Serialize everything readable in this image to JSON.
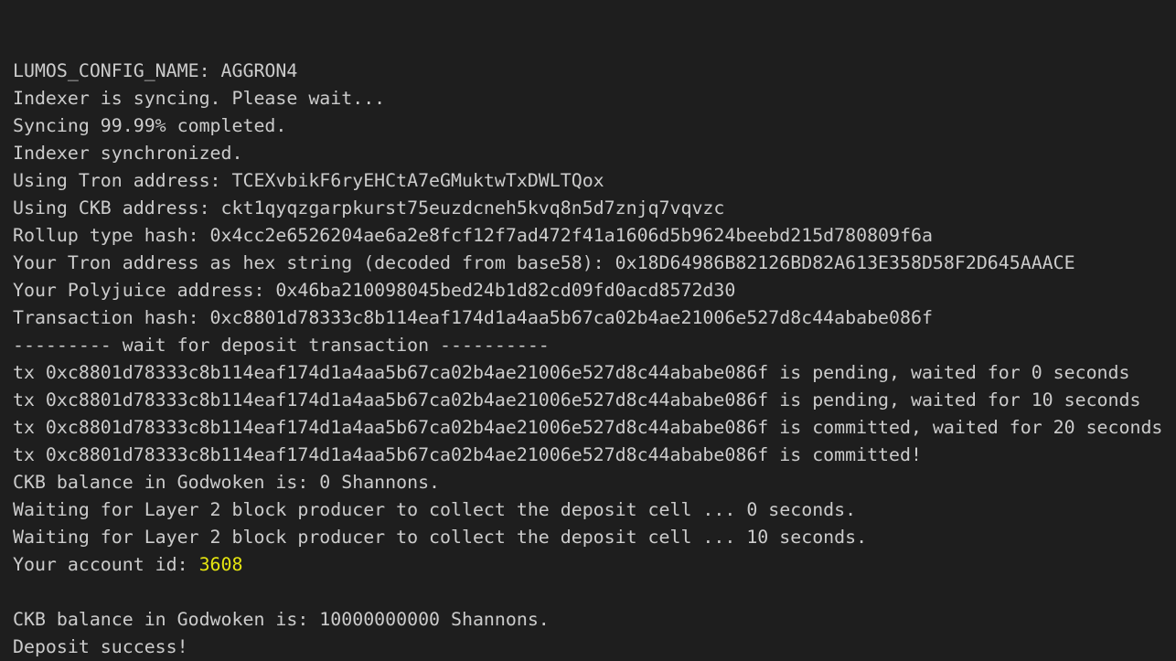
{
  "colors": {
    "background": "#1e1e1e",
    "text": "#cccccc",
    "highlight": "#e5e510"
  },
  "terminal": {
    "lines": [
      "LUMOS_CONFIG_NAME: AGGRON4",
      "Indexer is syncing. Please wait...",
      "Syncing 99.99% completed.",
      "Indexer synchronized.",
      "Using Tron address: TCEXvbikF6ryEHCtA7eGMuktwTxDWLTQox",
      "Using CKB address: ckt1qyqzgarpkurst75euzdcneh5kvq8n5d7znjq7vqvzc",
      "Rollup type hash: 0x4cc2e6526204ae6a2e8fcf12f7ad472f41a1606d5b9624beebd215d780809f6a",
      "Your Tron address as hex string (decoded from base58): 0x18D64986B82126BD82A613E358D58F2D645AAACE",
      "Your Polyjuice address: 0x46ba210098045bed24b1d82cd09fd0acd8572d30",
      "Transaction hash: 0xc8801d78333c8b114eaf174d1a4aa5b67ca02b4ae21006e527d8c44ababe086f",
      "--------- wait for deposit transaction ----------",
      "tx 0xc8801d78333c8b114eaf174d1a4aa5b67ca02b4ae21006e527d8c44ababe086f is pending, waited for 0 seconds",
      "tx 0xc8801d78333c8b114eaf174d1a4aa5b67ca02b4ae21006e527d8c44ababe086f is pending, waited for 10 seconds",
      "tx 0xc8801d78333c8b114eaf174d1a4aa5b67ca02b4ae21006e527d8c44ababe086f is committed, waited for 20 seconds",
      "tx 0xc8801d78333c8b114eaf174d1a4aa5b67ca02b4ae21006e527d8c44ababe086f is committed!",
      "CKB balance in Godwoken is: 0 Shannons.",
      "Waiting for Layer 2 block producer to collect the deposit cell ... 0 seconds.",
      "Waiting for Layer 2 block producer to collect the deposit cell ... 10 seconds."
    ],
    "account_id_label": "Your account id: ",
    "account_id": "3608",
    "after_lines": [
      "CKB balance in Godwoken is: 10000000000 Shannons.",
      "Deposit success!"
    ]
  }
}
